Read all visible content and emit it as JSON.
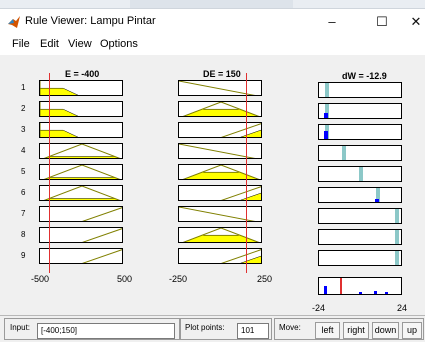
{
  "window": {
    "title": "Rule Viewer: Lampu Pintar"
  },
  "menu": [
    "File",
    "Edit",
    "View",
    "Options"
  ],
  "inputs_header": [
    "E = -400",
    "DE = 150"
  ],
  "output_header": "dW = -12.9",
  "rules": [
    "1",
    "2",
    "3",
    "4",
    "5",
    "6",
    "7",
    "8",
    "9"
  ],
  "axes": {
    "E": [
      "-500",
      "500"
    ],
    "DE": [
      "-250",
      "250"
    ],
    "dW": [
      "-24",
      "24"
    ]
  },
  "bottom": {
    "input_label": "Input:",
    "input_value": "[-400;150]",
    "plot_points_label": "Plot points:",
    "plot_points_value": "101",
    "move_label": "Move:",
    "buttons": [
      "left",
      "right",
      "down",
      "up"
    ]
  },
  "colors": {
    "fill": "#ffff00",
    "edge": "#808000",
    "line": "#e03030",
    "out_bar": "#8cc8c8",
    "out_fill": "#0000ff"
  }
}
